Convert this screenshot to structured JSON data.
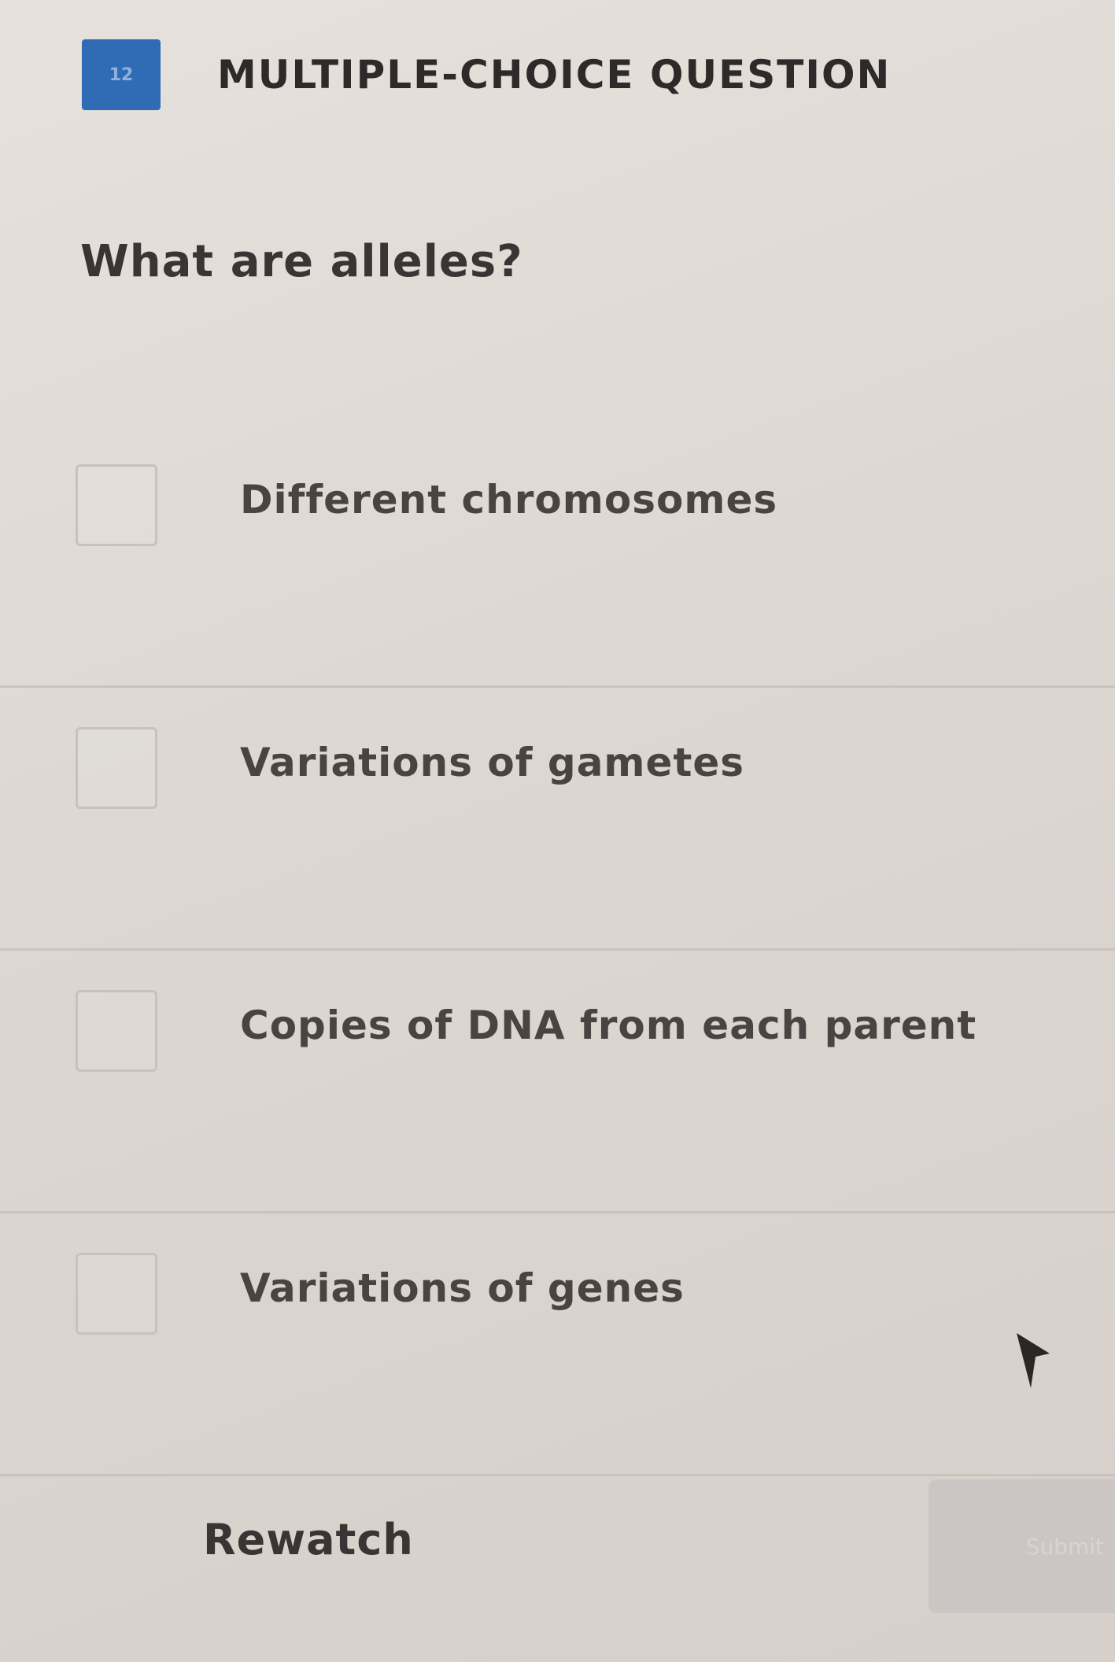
{
  "header": {
    "badge_number": "12",
    "question_type": "MULTIPLE-CHOICE QUESTION"
  },
  "question": {
    "text": "What are alleles?"
  },
  "options": [
    {
      "label": "Different chromosomes",
      "checked": false
    },
    {
      "label": "Variations of gametes",
      "checked": false
    },
    {
      "label": "Copies of DNA from each parent",
      "checked": false
    },
    {
      "label": "Variations of genes",
      "checked": false
    }
  ],
  "footer": {
    "rewatch_label": "Rewatch",
    "submit_label": "Submit"
  },
  "colors": {
    "badge": "#2f6cb5",
    "background": "#e0dad5",
    "text": "#3a3534"
  }
}
